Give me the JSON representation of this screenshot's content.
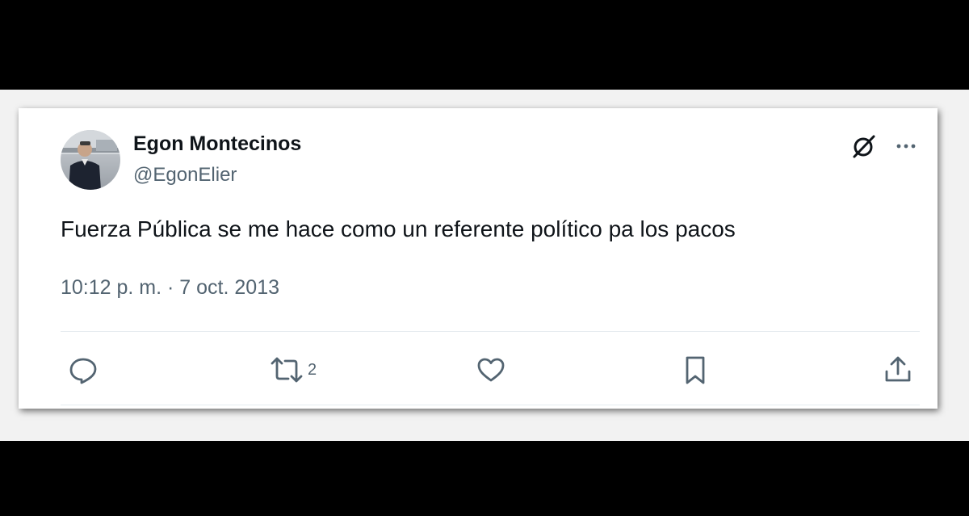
{
  "tweet": {
    "author_name": "Egon Montecinos",
    "author_handle": "@EgonElier",
    "text": "Fuerza Pública se me hace como un referente político pa los pacos",
    "timestamp": "10:12 p. m. · 7 oct. 2013"
  },
  "header_icons": {
    "grok": "grok-icon",
    "more": "more-icon"
  },
  "actions": {
    "reply": {
      "icon": "reply-icon",
      "count": ""
    },
    "retweet": {
      "icon": "retweet-icon",
      "count": "2"
    },
    "like": {
      "icon": "heart-icon",
      "count": ""
    },
    "bookmark": {
      "icon": "bookmark-icon",
      "count": ""
    },
    "share": {
      "icon": "share-icon",
      "count": ""
    }
  },
  "colors": {
    "text_primary": "#0f1419",
    "text_secondary": "#536471",
    "divider": "#e6ecf0",
    "background_bands": "#000000"
  }
}
